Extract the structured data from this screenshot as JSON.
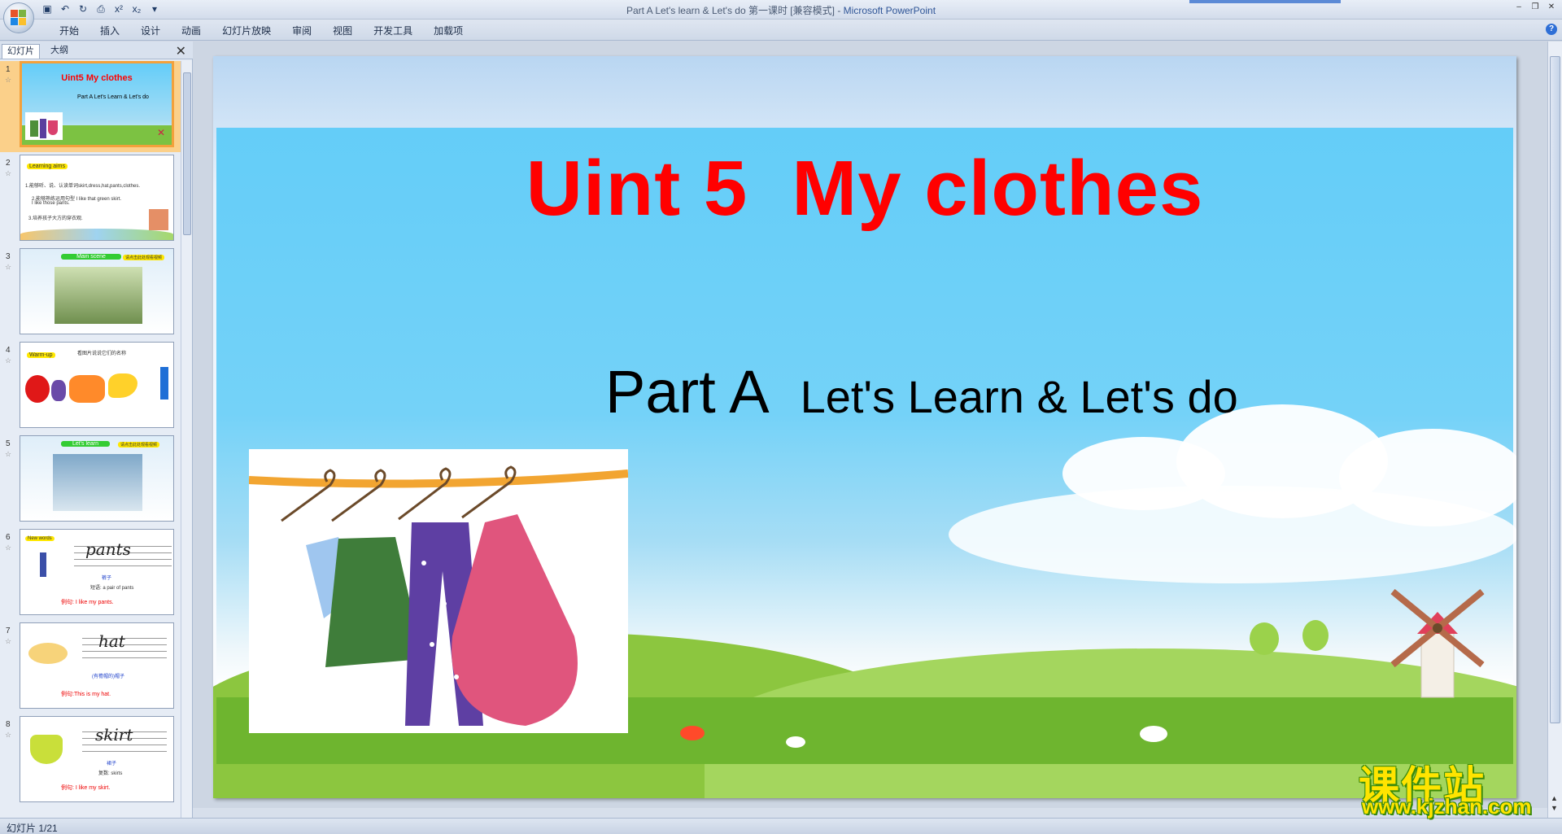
{
  "window": {
    "title": "Part A Let's learn & Let's do 第一课时  [兼容模式]",
    "separator": " - ",
    "app_name": "Microsoft PowerPoint"
  },
  "ribbon": {
    "tabs": [
      "开始",
      "插入",
      "设计",
      "动画",
      "幻灯片放映",
      "审阅",
      "视图",
      "开发工具",
      "加载项"
    ]
  },
  "left_pane": {
    "tab_slides": "幻灯片",
    "tab_outline": "大纲",
    "slides": [
      {
        "num": "1",
        "title": "Uint5  My clothes",
        "subtitle": "Part A  Let's Learn & Let's do"
      },
      {
        "num": "2",
        "badge": "Learning aims",
        "lines": [
          "1.能够听、说、认读单词skirt,dress,hat,pants,clothes.",
          "2.能够熟练运用句型 I like that green skirt.",
          "I like those pants.",
          "3.培养孩子大方的穿衣观."
        ]
      },
      {
        "num": "3",
        "badge": "Main scene",
        "side_label": "请点击此处观看视频"
      },
      {
        "num": "4",
        "badge": "Warm-up",
        "note": "看图片说说它们的名称"
      },
      {
        "num": "5",
        "badge": "Let's learn",
        "side_label": "请点击此处观看视频"
      },
      {
        "num": "6",
        "badge": "New words",
        "word": "pants",
        "meaning": "裤子",
        "phrase": "短语: a pair of pants",
        "example": "例句: I like my pants."
      },
      {
        "num": "7",
        "word": "hat",
        "meaning": "(有檐帽的)帽子",
        "example": "例句:This is my hat."
      },
      {
        "num": "8",
        "word": "skirt",
        "meaning": "裙子",
        "phrase": "复数: skirts",
        "example": "例句: I like my skirt."
      }
    ]
  },
  "slide": {
    "title_part1": "Uint 5",
    "title_part2": "My clothes",
    "subtitle_part": "Part A",
    "subtitle_rest": "Let's Learn & Let's do"
  },
  "status": {
    "slide_counter": "幻灯片 1/21"
  },
  "watermark": {
    "brand": "课件站",
    "url": "www.kjzhan.com"
  },
  "colors": {
    "title_red": "#ff0000",
    "sky_blue": "#64cdf8",
    "grass_green": "#7cc242",
    "selected_orange": "#f3a13b",
    "watermark_yellow": "#ffe400"
  }
}
